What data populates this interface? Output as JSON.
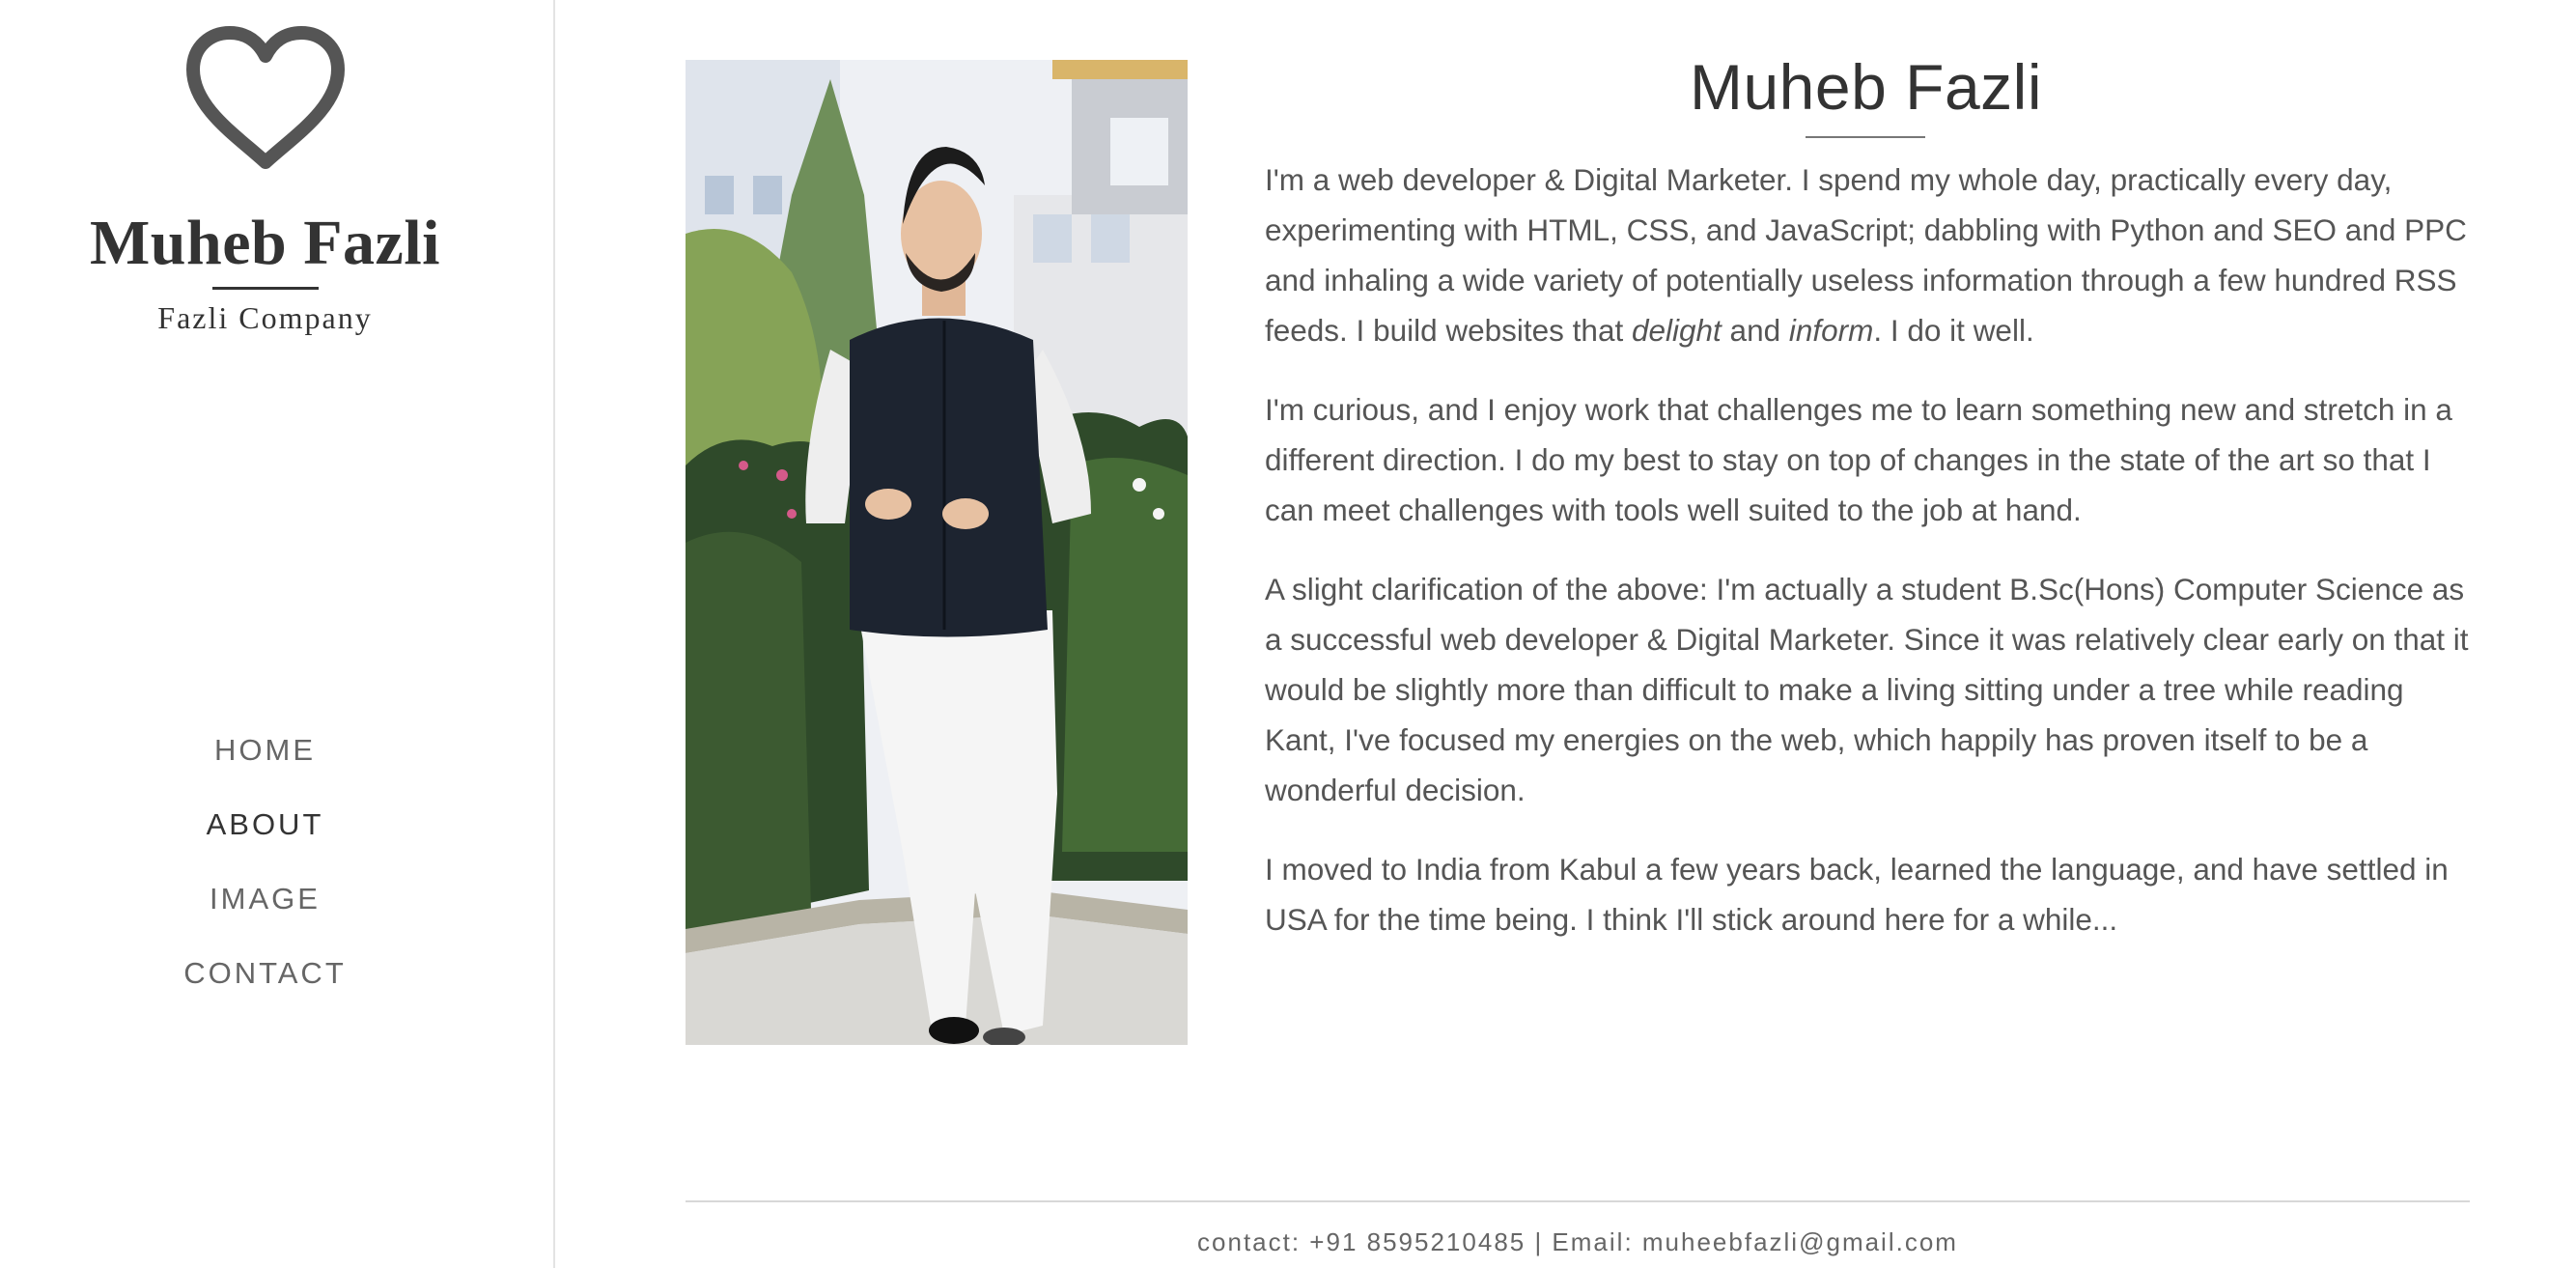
{
  "sidebar": {
    "logo_icon": "heart-outline-icon",
    "brand_name": "Muheb Fazli",
    "brand_subtitle": "Fazli Company",
    "nav": [
      {
        "label": "HOME",
        "active": false
      },
      {
        "label": "ABOUT",
        "active": true
      },
      {
        "label": "IMAGE",
        "active": false
      },
      {
        "label": "CONTACT",
        "active": false
      }
    ]
  },
  "main": {
    "title": "Muheb Fazli",
    "photo_icon": "portrait-photo",
    "paragraphs": {
      "p1": {
        "a": "I'm a web developer & Digital Marketer. I spend my whole day, practically every day, experimenting with HTML, CSS, and JavaScript; dabbling with Python and SEO and PPC and inhaling a wide variety of potentially useless information through a few hundred RSS feeds. I build websites that ",
        "em1": "delight",
        "b": " and ",
        "em2": "inform",
        "c": ". I do it well."
      },
      "p2": "I'm curious, and I enjoy work that challenges me to learn something new and stretch in a different direction. I do my best to stay on top of changes in the state of the art so that I can meet challenges with tools well suited to the job at hand.",
      "p3": "A slight clarification of the above: I'm actually a student B.Sc(Hons) Computer Science as a successful web developer & Digital Marketer. Since it was relatively clear early on that it would be slightly more than difficult to make a living sitting under a tree while reading Kant, I've focused my energies on the web, which happily has proven itself to be a wonderful decision.",
      "p4": "I moved to India from Kabul a few years back, learned the language, and have settled in USA for the time being. I think I'll stick around here for a while..."
    }
  },
  "footer": {
    "text": "contact: +91 8595210485 | Email: muheebfazli@gmail.com"
  },
  "colors": {
    "text": "#555555",
    "heading": "#333333",
    "nav": "#666666",
    "divider": "#e3e3e3",
    "icon": "#555555"
  }
}
